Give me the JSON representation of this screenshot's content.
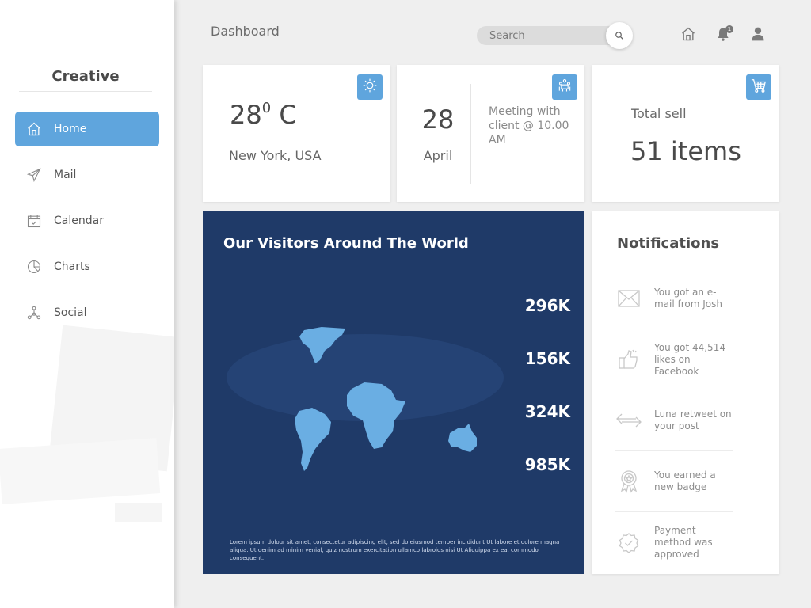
{
  "sidebar": {
    "brand": "Creative",
    "items": [
      {
        "label": "Home",
        "icon": "home-icon",
        "active": true
      },
      {
        "label": "Mail",
        "icon": "paper-plane-icon",
        "active": false
      },
      {
        "label": "Calendar",
        "icon": "calendar-icon",
        "active": false
      },
      {
        "label": "Charts",
        "icon": "pie-chart-icon",
        "active": false
      },
      {
        "label": "Social",
        "icon": "network-icon",
        "active": false
      }
    ]
  },
  "header": {
    "title": "Dashboard",
    "search_placeholder": "Search",
    "notification_count": "1"
  },
  "weather": {
    "temperature": "28",
    "degree": "0",
    "unit": " C",
    "location": "New York, USA"
  },
  "event": {
    "day": "28",
    "month": "April",
    "text": "Meeting with client @ 10.00 AM"
  },
  "sales": {
    "label": "Total sell",
    "value": "51 items"
  },
  "visitors": {
    "title": "Our Visitors Around The World",
    "stats": [
      "296K",
      "156K",
      "324K",
      "985K"
    ],
    "description": "Lorem ipsum dolour sit amet, consectetur adipiscing elit, sed do eiusmod temper incididunt Ut labore et dolore magna aliqua. Ut denim ad minim venial, quiz nostrum exercitation ullamco labroids nisi Ut Aliquippa ex ea. commodo consequent."
  },
  "notifications": {
    "title": "Notifications",
    "items": [
      {
        "text": "You got an e-mail from Josh",
        "icon": "envelope-icon"
      },
      {
        "text": "You got 44,514 likes on Facebook",
        "icon": "thumbs-up-icon"
      },
      {
        "text": "Luna retweet on your post",
        "icon": "retweet-icon"
      },
      {
        "text": "You earned a new badge",
        "icon": "badge-icon"
      },
      {
        "text": "Payment method was approved",
        "icon": "approved-icon"
      }
    ]
  },
  "colors": {
    "accent": "#5fa5dd",
    "map_background": "#1f3a68",
    "continent": "#6aaee3"
  }
}
